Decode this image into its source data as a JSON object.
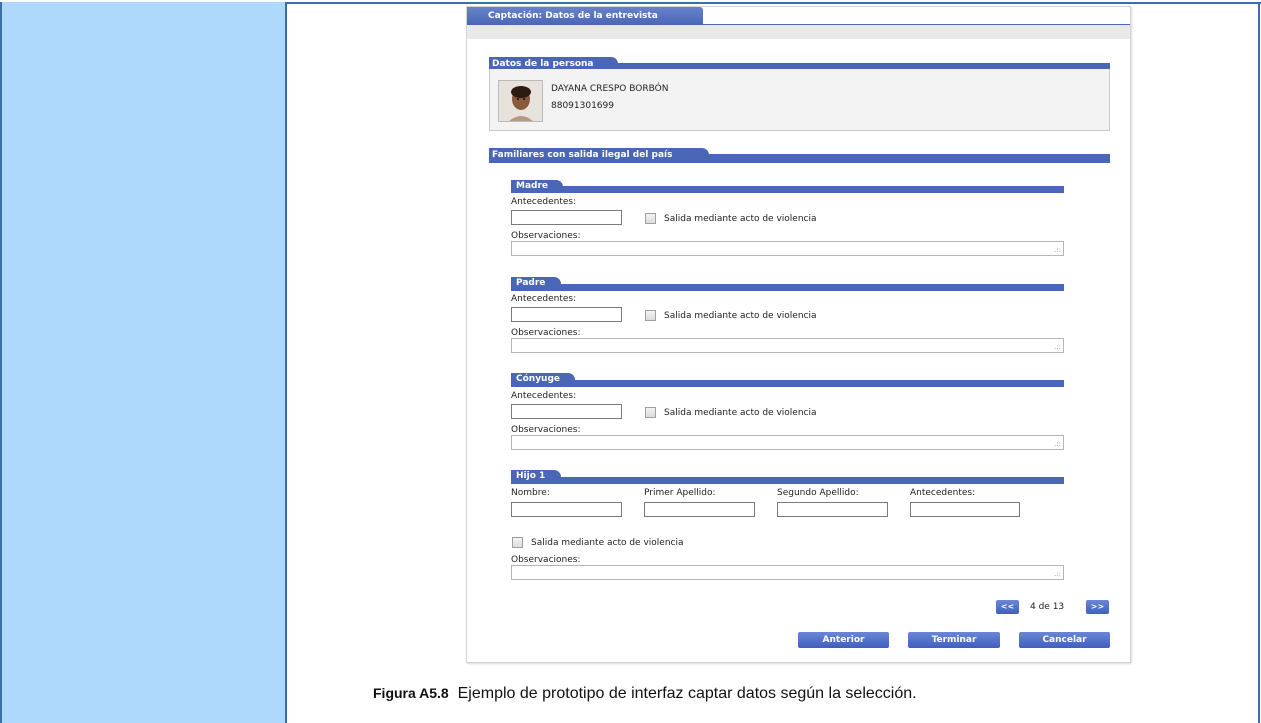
{
  "app": {
    "tab_title": "Captación: Datos de la entrevista"
  },
  "person_section": {
    "title": "Datos de la persona",
    "name": "DAYANA CRESPO BORBÓN",
    "id_number": "88091301699"
  },
  "relatives_section": {
    "title": "Familiares con salida ilegal del país",
    "madre": {
      "title": "Madre",
      "antecedentes_label": "Antecedentes:",
      "antecedentes_value": "",
      "violence_label": "Salida mediante acto de violencia",
      "observaciones_label": "Observaciones:",
      "observaciones_value": ""
    },
    "padre": {
      "title": "Padre",
      "antecedentes_label": "Antecedentes:",
      "antecedentes_value": "",
      "violence_label": "Salida mediante acto de violencia",
      "observaciones_label": "Observaciones:",
      "observaciones_value": ""
    },
    "conyuge": {
      "title": "Cónyuge",
      "antecedentes_label": "Antecedentes:",
      "antecedentes_value": "",
      "violence_label": "Salida mediante acto de violencia",
      "observaciones_label": "Observaciones:",
      "observaciones_value": ""
    },
    "hijo1": {
      "title": "Hijo 1",
      "nombre_label": "Nombre:",
      "primer_apellido_label": "Primer Apellido:",
      "segundo_apellido_label": "Segundo Apellido:",
      "antecedentes_label": "Antecedentes:",
      "violence_label": "Salida mediante acto de violencia",
      "observaciones_label": "Observaciones:"
    }
  },
  "pagination": {
    "prev_label": "<<",
    "next_label": ">>",
    "status": "4 de 13"
  },
  "actions": {
    "anterior": "Anterior",
    "terminar": "Terminar",
    "cancelar": "Cancelar"
  },
  "caption": {
    "label": "Figura A5.8",
    "text": "Ejemplo de prototipo de interfaz captar datos según la selección."
  },
  "colors": {
    "accent": "#4a66b6",
    "left_panel": "#aed8fc",
    "frame": "#3d6ea8"
  }
}
